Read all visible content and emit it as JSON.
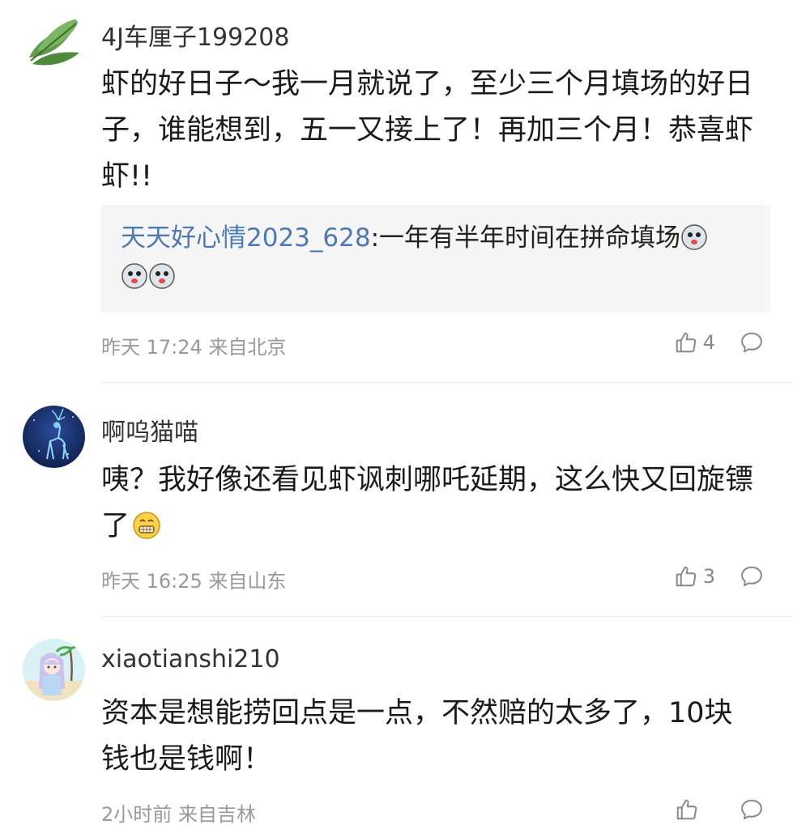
{
  "comments": [
    {
      "username": "4J车厘子199208",
      "text": "虾的好日子～我一月就说了，至少三个月填场的好日子，谁能想到，五一又接上了！再加三个月！恭喜虾虾!!",
      "reply": {
        "username": "天天好心情2023_628",
        "separator": ":",
        "text": "一年有半年时间在拼命填场"
      },
      "meta": "昨天 17:24 来自北京",
      "likes": "4",
      "avatar_icon": "leaf-icon"
    },
    {
      "username": "啊呜猫喵",
      "text": "咦？我好像还看见虾讽刺哪吒延期，这么快又回旋镖了",
      "meta": "昨天 16:25 来自山东",
      "likes": "3",
      "avatar_icon": "deer-icon"
    },
    {
      "username": "xiaotianshi210",
      "text": "资本是想能捞回点是一点，不然赔的太多了，10块钱也是钱啊！",
      "meta": "2小时前 来自吉林",
      "likes": "",
      "avatar_icon": "anime-girl-icon"
    }
  ],
  "colors": {
    "reply_user": "#4d78b2",
    "meta": "#999999",
    "reply_bg": "#f5f5f5"
  }
}
